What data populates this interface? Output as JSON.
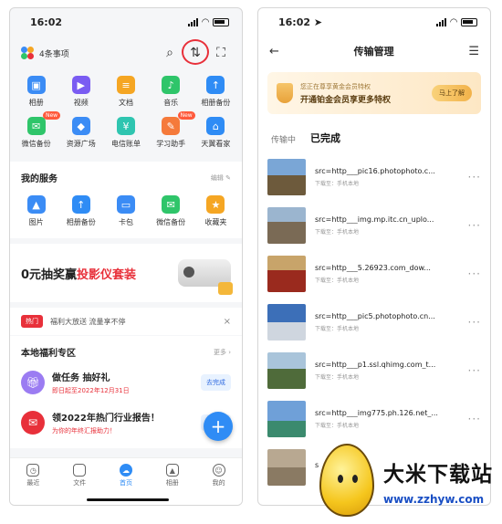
{
  "left": {
    "status_time": "16:02",
    "header_title": "4条事项",
    "quick_grid": [
      {
        "label": "相册",
        "icon": "album-icon",
        "color": "#3b8cf5"
      },
      {
        "label": "视频",
        "icon": "video-icon",
        "color": "#7a5cf2"
      },
      {
        "label": "文档",
        "icon": "document-icon",
        "color": "#f5a623"
      },
      {
        "label": "音乐",
        "icon": "music-icon",
        "color": "#2fc56a"
      },
      {
        "label": "相册备份",
        "icon": "album-backup-icon",
        "color": "#2f8cf5"
      },
      {
        "label": "微信备份",
        "icon": "wechat-backup-icon",
        "color": "#2fc56a"
      },
      {
        "label": "资源广场",
        "icon": "resource-icon",
        "color": "#3b8cf5"
      },
      {
        "label": "电信账单",
        "icon": "bill-icon",
        "color": "#2fc5b0"
      },
      {
        "label": "学习助手",
        "icon": "study-icon",
        "color": "#f57a3b"
      },
      {
        "label": "天翼看家",
        "icon": "home-camera-icon",
        "color": "#2f8cf5"
      }
    ],
    "new_tag": "New",
    "services_title": "我的服务",
    "services_edit": "编辑",
    "services": [
      {
        "label": "图片",
        "icon": "picture-icon",
        "color": "#3b8cf5"
      },
      {
        "label": "相册备份",
        "icon": "album-backup-icon",
        "color": "#2f8cf5"
      },
      {
        "label": "卡包",
        "icon": "card-icon",
        "color": "#3b8cf5"
      },
      {
        "label": "微信备份",
        "icon": "wechat-backup-icon",
        "color": "#2fc56a"
      },
      {
        "label": "收藏夹",
        "icon": "favorites-icon",
        "color": "#f5a623"
      }
    ],
    "banner_text_a": "0元抽奖赢",
    "banner_text_b": "投影仪套装",
    "hot_tag": "热门",
    "hot_msg": "福利大放送 流量享不停",
    "welfare_title": "本地福利专区",
    "welfare_more": "更多",
    "tasks": [
      {
        "title": "做任务 抽好礼",
        "sub": "即日起至2022年12月31日",
        "btn": "去完成",
        "color": "#9b7cf2"
      },
      {
        "title": "领2022年热门行业报告！",
        "sub": "为你的年终汇报助力！",
        "btn": "去完成",
        "color": "#e8303a"
      }
    ],
    "tabs": [
      {
        "label": "最近",
        "active": false
      },
      {
        "label": "文件",
        "active": false
      },
      {
        "label": "首页",
        "active": true
      },
      {
        "label": "相册",
        "active": false
      },
      {
        "label": "我的",
        "active": false
      }
    ]
  },
  "right": {
    "status_time": "16:02",
    "title": "传输管理",
    "vip_line1": "您正在尊享黄金会员特权",
    "vip_line2": "开通铂金会员享更多特权",
    "vip_btn": "马上了解",
    "tab_uploading": "传输中",
    "tab_done": "已完成",
    "files": [
      {
        "name": "src=http___pic16.photophoto.c...",
        "sub": "下载至：手机本地",
        "colors": [
          "#7aa6d6",
          "#6d5a3c"
        ]
      },
      {
        "name": "src=http___img.mp.itc.cn_uplo...",
        "sub": "下载至：手机本地",
        "colors": [
          "#9bb5cf",
          "#7a6a55"
        ]
      },
      {
        "name": "src=http___5.26923.com_dow...",
        "sub": "下载至：手机本地",
        "colors": [
          "#c8a46a",
          "#9a2a1e"
        ]
      },
      {
        "name": "src=http___pic5.photophoto.cn...",
        "sub": "下载至：手机本地",
        "colors": [
          "#3c6fb8",
          "#cfd6df"
        ]
      },
      {
        "name": "src=http___p1.ssl.qhimg.com_t...",
        "sub": "下载至：手机本地",
        "colors": [
          "#a9c4da",
          "#4f6b3a"
        ]
      },
      {
        "name": "src=http___img775.ph.126.net_...",
        "sub": "下载至：手机本地",
        "colors": [
          "#6fa0d8",
          "#3b8a6e"
        ]
      },
      {
        "name": "s",
        "sub": "",
        "colors": [
          "#b8a891",
          "#8a7a63"
        ]
      }
    ]
  },
  "watermark": {
    "title": "大米下载站",
    "url": "www.zzhyw.com"
  }
}
